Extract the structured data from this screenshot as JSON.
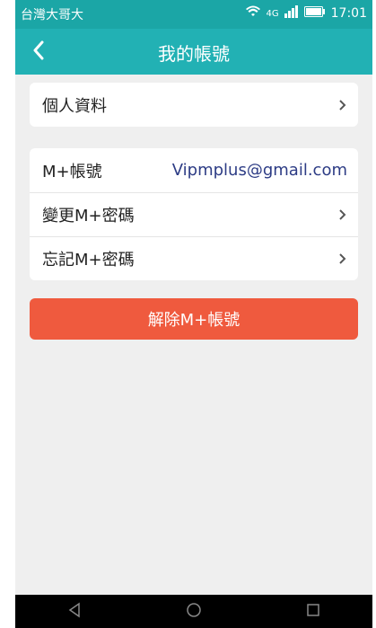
{
  "status": {
    "carrier": "台灣大哥大",
    "network": "4G",
    "time": "17:01"
  },
  "header": {
    "title": "我的帳號"
  },
  "profile": {
    "label": "個人資料"
  },
  "account": {
    "label": "M+帳號",
    "value": "Vipmplus@gmail.com",
    "change_password": "變更M+密碼",
    "forgot_password": "忘記M+密碼"
  },
  "actions": {
    "remove_account": "解除M+帳號"
  },
  "colors": {
    "statusbar": "#1ba6a6",
    "header": "#22b1b4",
    "danger": "#ef5a3e",
    "email": "#2d3c85"
  },
  "icons": {
    "back": "back-icon",
    "wifi": "wifi-icon",
    "signal": "signal-icon",
    "battery": "battery-icon",
    "chevron": "chevron-right-icon",
    "nav_back": "nav-back-icon",
    "home": "home-icon",
    "recents": "recents-icon"
  }
}
